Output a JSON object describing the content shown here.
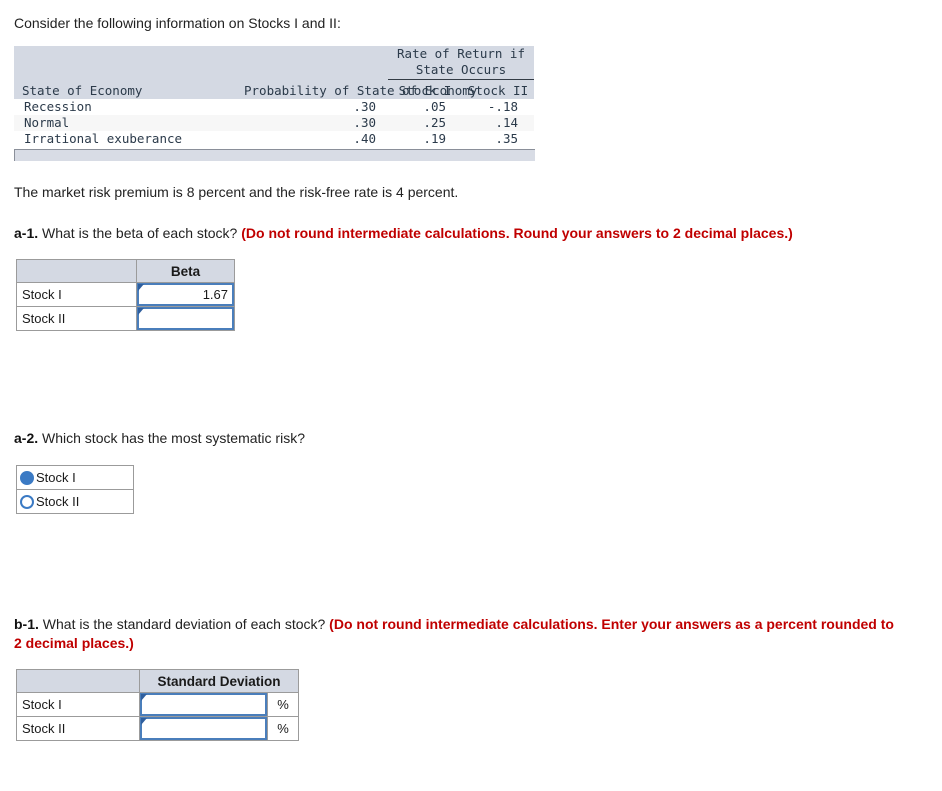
{
  "intro": "Consider the following information on Stocks I and II:",
  "data_table": {
    "group_header_line1": "Rate of Return if",
    "group_header_line2": "State Occurs",
    "col_state": "State of Economy",
    "col_prob_line1": "Probability of",
    "col_prob_line2": "State of Economy",
    "col_stock1": "Stock I",
    "col_stock2": "Stock II",
    "rows": [
      {
        "state": "Recession",
        "prob": ".30",
        "stock1": ".05",
        "stock2": "-.18"
      },
      {
        "state": "Normal",
        "prob": ".30",
        "stock1": ".25",
        "stock2": ".14"
      },
      {
        "state": "Irrational exuberance",
        "prob": ".40",
        "stock1": ".19",
        "stock2": ".35"
      }
    ]
  },
  "market_info": "The market risk premium is 8 percent and the risk-free rate is 4 percent.",
  "question_a1": {
    "label": "a-1.",
    "text": "What is the beta of each stock?",
    "note": "(Do not round intermediate calculations. Round your answers to 2 decimal places.)"
  },
  "beta_table": {
    "blank_header": "",
    "header": "Beta",
    "rows": [
      {
        "label": "Stock I",
        "value": "1.67"
      },
      {
        "label": "Stock II",
        "value": ""
      }
    ]
  },
  "question_a2": {
    "label": "a-2.",
    "text": "Which stock has the most systematic risk?"
  },
  "radio_options": [
    {
      "label": "Stock I",
      "selected": true
    },
    {
      "label": "Stock II",
      "selected": false
    }
  ],
  "question_b1": {
    "label": "b-1.",
    "text": "What is the standard deviation of each stock?",
    "note": "(Do not round intermediate calculations. Enter your answers as a percent rounded to 2 decimal places.)"
  },
  "stddev_table": {
    "blank_header": "",
    "header": "Standard Deviation",
    "percent_symbol": "%",
    "rows": [
      {
        "label": "Stock I",
        "value": ""
      },
      {
        "label": "Stock II",
        "value": ""
      }
    ]
  },
  "colors": {
    "header_bg": "#d4d9e3",
    "input_border": "#4a7ebb",
    "note_red": "#c00000",
    "radio_blue": "#3b7ac4"
  }
}
